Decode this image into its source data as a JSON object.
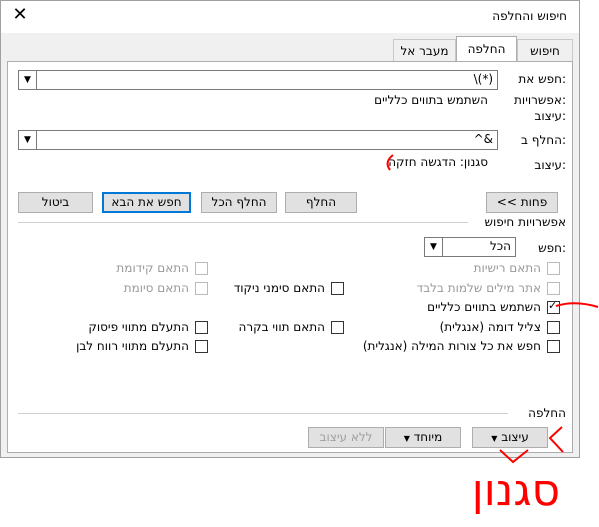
{
  "window": {
    "title": "חיפוש והחלפה",
    "close_symbol": "✕"
  },
  "tabs": [
    "חיפוש",
    "החלפה",
    "מעבר אל"
  ],
  "find": {
    "label": "חפש את:",
    "value": "\\(*)",
    "options_label": "אפשרויות:",
    "options_value": "השתמש בתווים כלליים",
    "format_label": "עיצוב:",
    "format_value": ""
  },
  "replace": {
    "label": "החלף ב:",
    "value": "^&",
    "format_label": "עיצוב:",
    "format_value": "סגנון: הדגשה חזקה"
  },
  "buttons": {
    "less": "<< פחות",
    "replace": "החלף",
    "replace_all": "החלף הכל",
    "find_next": "חפש את הבא",
    "cancel": "ביטול",
    "format": "עיצוב",
    "special": "מיוחד",
    "no_format": "ללא עיצוב"
  },
  "search_options": {
    "header": "אפשרויות חיפוש",
    "search_label": "חפש:",
    "search_value": "הכל",
    "checkboxes": [
      {
        "label": "התאם רישיות",
        "checked": false,
        "disabled": true
      },
      {
        "label": "אתר מילים שלמות בלבד",
        "checked": false,
        "disabled": true
      },
      {
        "label": "השתמש בתווים כלליים",
        "checked": true,
        "disabled": false
      },
      {
        "label": "צליל דומה (אנגלית)",
        "checked": false,
        "disabled": false
      },
      {
        "label": "חפש את כל צורות המילה (אנגלית)",
        "checked": false,
        "disabled": false
      },
      {
        "label": "התאם קידומת",
        "checked": false,
        "disabled": true
      },
      {
        "label": "התאם סיומת",
        "checked": false,
        "disabled": true
      },
      {
        "label": "התאם סימני ניקוד",
        "checked": false,
        "disabled": false
      },
      {
        "label": "התאם תווי בקרה",
        "checked": false,
        "disabled": false
      },
      {
        "label": "התעלם מתווי פיסוק",
        "checked": false,
        "disabled": false
      },
      {
        "label": "התעלם מתווי רווח לבן",
        "checked": false,
        "disabled": false
      }
    ]
  },
  "replace_section": {
    "header": "החלפה"
  },
  "annotation": {
    "handwritten": "סגנון",
    "color": "#ff0000"
  }
}
